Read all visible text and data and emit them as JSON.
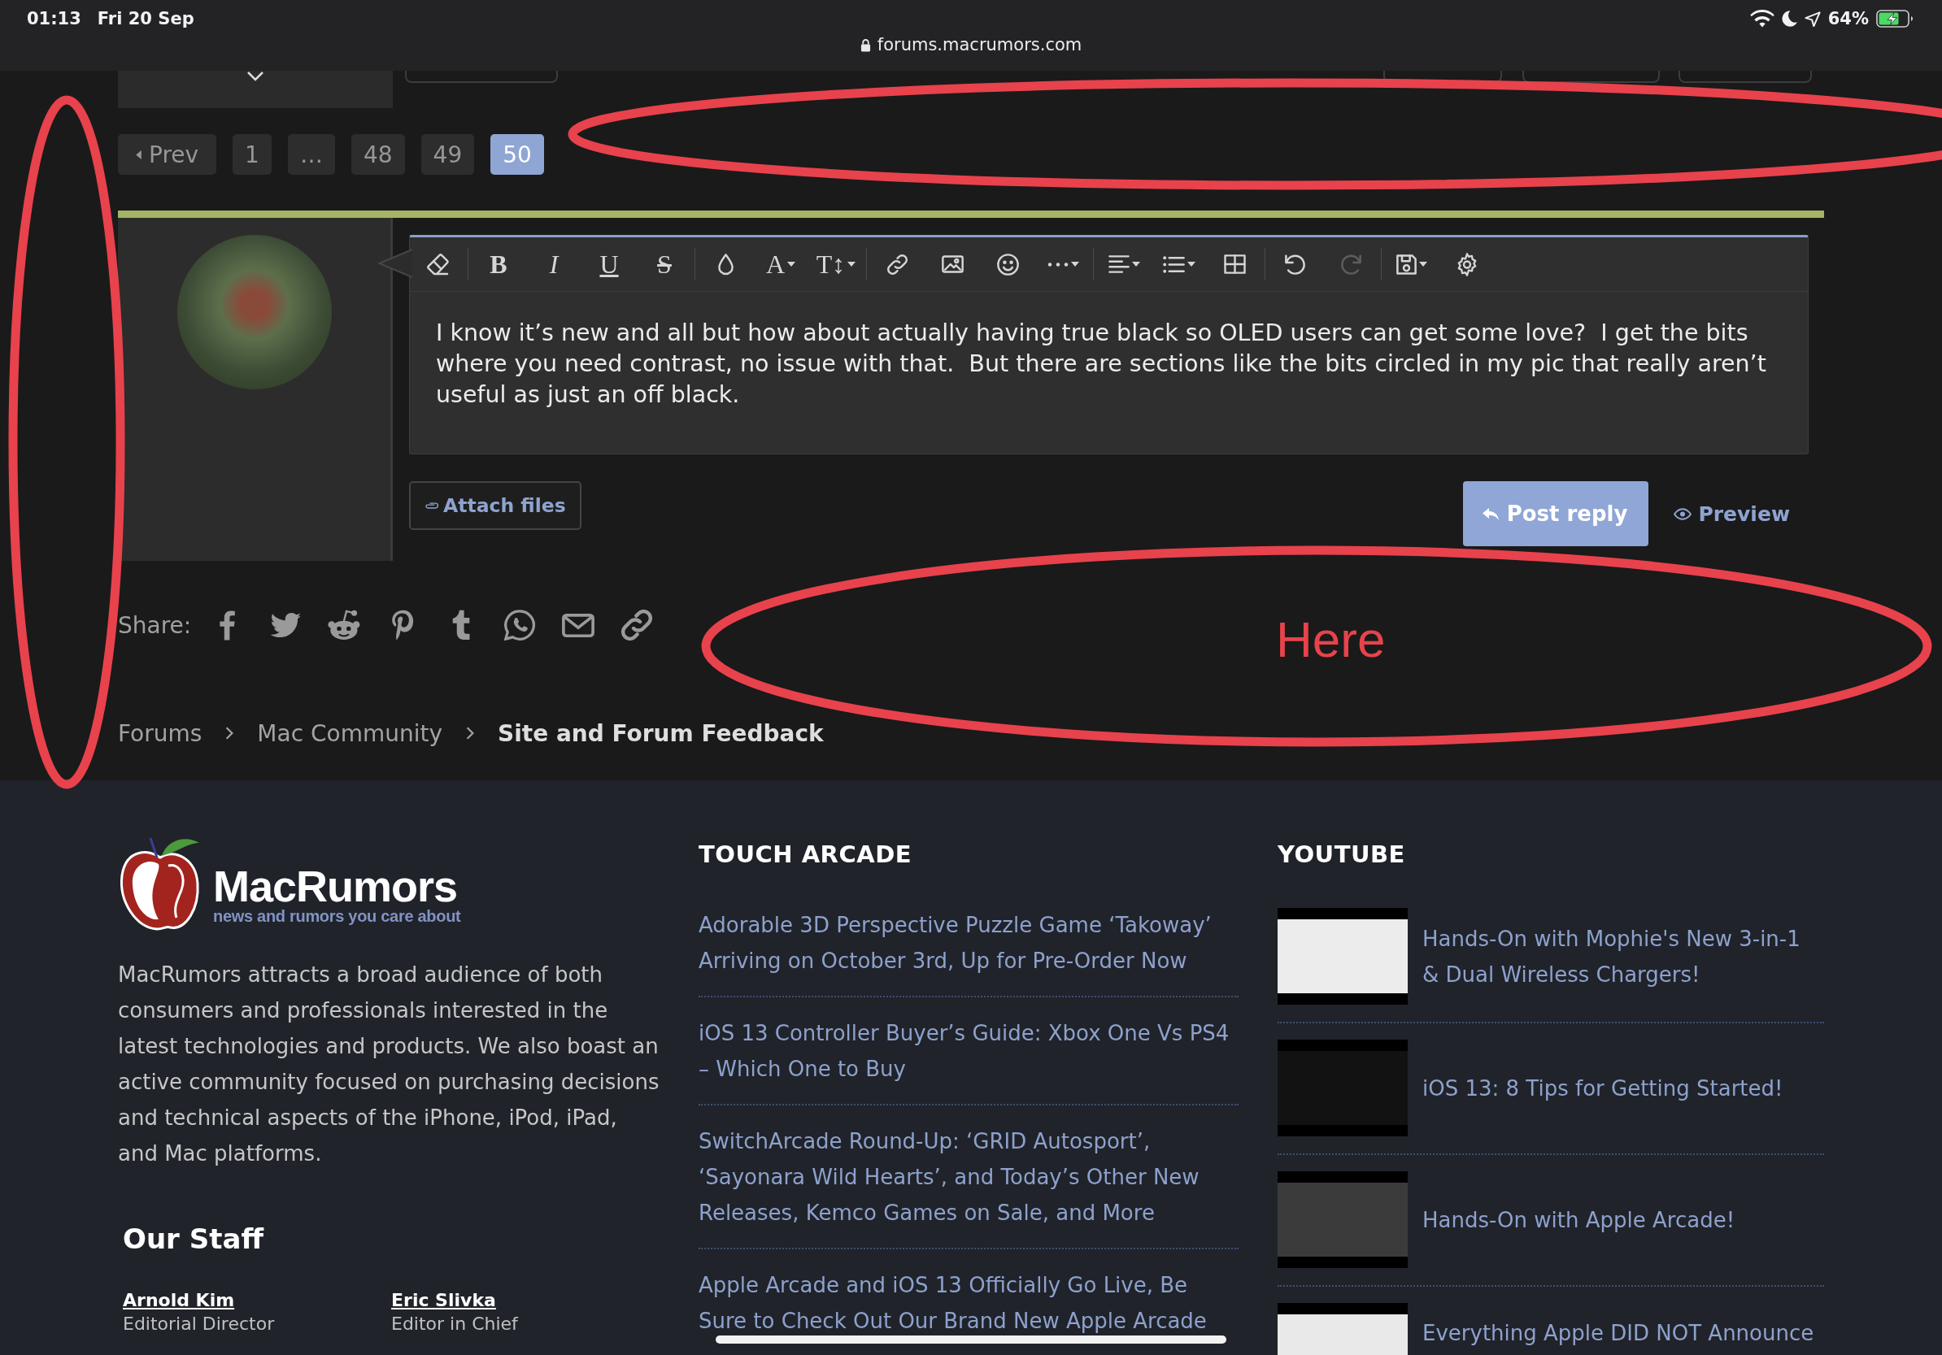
{
  "status_bar": {
    "time": "01:13",
    "date": "Fri 20 Sep",
    "url": "forums.macrumors.com",
    "battery": "64%"
  },
  "pagination": {
    "prev": "Prev",
    "pages": [
      {
        "label": "1",
        "selected": false
      },
      {
        "label": "…",
        "selected": false
      },
      {
        "label": "48",
        "selected": false
      },
      {
        "label": "49",
        "selected": false
      },
      {
        "label": "50",
        "selected": true
      }
    ]
  },
  "reply": {
    "toolbar": [
      [
        {
          "kind": "eraser",
          "disabled": false,
          "menu": false
        }
      ],
      [
        {
          "kind": "bold",
          "label": "B",
          "disabled": false,
          "menu": false
        },
        {
          "kind": "italic",
          "label": "I",
          "disabled": false,
          "menu": false
        },
        {
          "kind": "underline",
          "label": "U",
          "disabled": false,
          "menu": false
        },
        {
          "kind": "strike",
          "label": "S",
          "disabled": false,
          "menu": false
        }
      ],
      [
        {
          "kind": "color",
          "disabled": false,
          "menu": false
        },
        {
          "kind": "font",
          "label": "A",
          "disabled": false,
          "menu": true
        },
        {
          "kind": "size",
          "label": "T↕",
          "disabled": false,
          "menu": true
        }
      ],
      [
        {
          "kind": "link",
          "disabled": false,
          "menu": false
        },
        {
          "kind": "image",
          "disabled": false,
          "menu": false
        },
        {
          "kind": "smiley",
          "disabled": false,
          "menu": false
        },
        {
          "kind": "more",
          "disabled": false,
          "menu": true
        }
      ],
      [
        {
          "kind": "align",
          "disabled": false,
          "menu": true
        },
        {
          "kind": "list",
          "disabled": false,
          "menu": true
        },
        {
          "kind": "table",
          "disabled": false,
          "menu": false
        }
      ],
      [
        {
          "kind": "undo",
          "disabled": false,
          "menu": false
        },
        {
          "kind": "redo",
          "disabled": true,
          "menu": false
        }
      ],
      [
        {
          "kind": "save",
          "disabled": false,
          "menu": true
        },
        {
          "kind": "settings",
          "disabled": false,
          "menu": false
        }
      ]
    ],
    "message": "I know it’s new and all but how about actually having true black so OLED users can get some love?  I get the bits where you need contrast, no issue with that.  But there are sections like the bits circled in my pic that really aren’t useful as just an off black.",
    "attach": "Attach files",
    "submit": "Post reply",
    "preview": "Preview"
  },
  "share": {
    "label": "Share:",
    "targets": [
      {
        "kind": "facebook"
      },
      {
        "kind": "twitter"
      },
      {
        "kind": "reddit"
      },
      {
        "kind": "pinterest"
      },
      {
        "kind": "tumblr"
      },
      {
        "kind": "whatsapp"
      },
      {
        "kind": "email"
      },
      {
        "kind": "link"
      }
    ]
  },
  "breadcrumb": [
    {
      "label": "Forums",
      "current": false
    },
    {
      "label": "Mac Community",
      "current": false
    },
    {
      "label": "Site and Forum Feedback",
      "current": true
    }
  ],
  "annotation": {
    "label": "Here"
  },
  "footer": {
    "logo": {
      "name": "MacRumors",
      "tagline": "news and rumors you care about"
    },
    "about": "MacRumors attracts a broad audience of both consumers and professionals interested in the latest technologies and products. We also boast an active community focused on purchasing decisions and technical aspects of the iPhone, iPod, iPad, and Mac platforms.",
    "staff": {
      "heading": "Our Staff",
      "members": [
        {
          "name": "Arnold Kim",
          "role": "Editorial Director"
        },
        {
          "name": "Eric Slivka",
          "role": "Editor in Chief"
        }
      ]
    },
    "touch_arcade": {
      "heading": "TOUCH ARCADE",
      "links": [
        "Adorable 3D Perspective Puzzle Game ‘Takoway’ Arriving on October 3rd, Up for Pre-Order Now",
        "iOS 13 Controller Buyer’s Guide: Xbox One Vs PS4 – Which One to Buy",
        "SwitchArcade Round-Up: ‘GRID Autosport’, ‘Sayonara Wild Hearts’, and Today’s Other New Releases, Kemco Games on Sale, and More",
        "Apple Arcade and iOS 13 Officially Go Live, Be Sure to Check Out Our Brand New Apple Arcade"
      ]
    },
    "youtube": {
      "heading": "YOUTUBE",
      "videos": [
        {
          "title": "Hands-On with Mophie's New 3-in-1 & Dual Wireless Chargers!"
        },
        {
          "title": "iOS 13: 8 Tips for Getting Started!"
        },
        {
          "title": "Hands-On with Apple Arcade!"
        },
        {
          "title": "Everything Apple DID NOT Announce"
        }
      ]
    }
  }
}
